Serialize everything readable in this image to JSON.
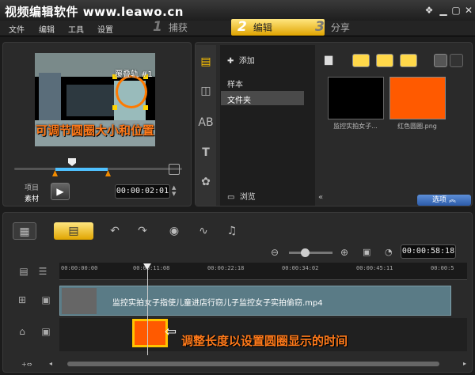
{
  "title": "视频编辑软件 www.leawo.cn",
  "menu": [
    "文件",
    "编辑",
    "工具",
    "设置"
  ],
  "steps": [
    {
      "num": "1",
      "label": "捕获"
    },
    {
      "num": "2",
      "label": "编辑"
    },
    {
      "num": "3",
      "label": "分享"
    }
  ],
  "preview": {
    "overlay_label": "覆叠轨 #1",
    "caption": "可调节圆圈大小和位置",
    "mode_project": "项目",
    "mode_clip": "素材",
    "timecode": "00:00:02:01"
  },
  "library": {
    "add_label": "添加",
    "folders": [
      "样本",
      "文件夹"
    ],
    "browse_label": "浏览",
    "items": [
      {
        "label": "监控实拍女子..."
      },
      {
        "label": "红色圆圈.png"
      }
    ],
    "options_label": "选项"
  },
  "timeline": {
    "total_timecode": "00:00:58:18",
    "ruler": [
      "00:00:00:00",
      "00:00:11:08",
      "00:00:22:18",
      "00:00:34:02",
      "00:00:45:11",
      "00:00:5"
    ],
    "video_clip_title": "监控实拍女子指使儿童进店行窃儿子监控女子实拍偷窃.mp4",
    "caption": "调整长度以设置圆圈显示的时间"
  },
  "colors": {
    "accent": "#ffc400",
    "caption": "#ff7a1a",
    "overlay_clip": "#ff5a00",
    "track": "#5a7b86"
  }
}
